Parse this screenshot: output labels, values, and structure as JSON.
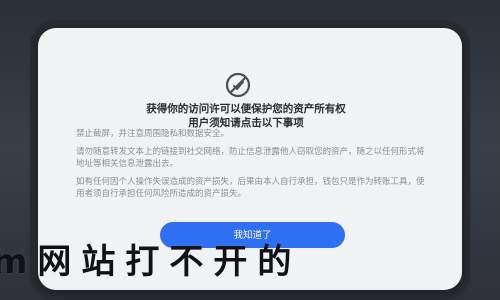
{
  "top_faint_text": "········",
  "modal": {
    "icon": "shield-icon",
    "title": "获得你的访问许可以便保护您的资产所有权\n用户须知请点击以下事项",
    "paragraphs": [
      "禁止截屏，并注意周围隐私和数据安全。",
      "请勿随意转发文本上的链接到社交网络，防止信息泄露他人窃取您的资产，随之以任何形式将地址等相关信息泄露出去。",
      "如有任何因个人操作失误造成的资产损失，后果由本人自行承担，钱包只是作为转账工具，使用者须自行承担任何风险所造成的资产损失。"
    ],
    "button_label": "我知道了"
  },
  "overlay": {
    "text": "m网站打不开的"
  },
  "colors": {
    "accent": "#2f6ff2",
    "modal_bg": "#f1f2f4",
    "backdrop": "#2a2c31"
  }
}
